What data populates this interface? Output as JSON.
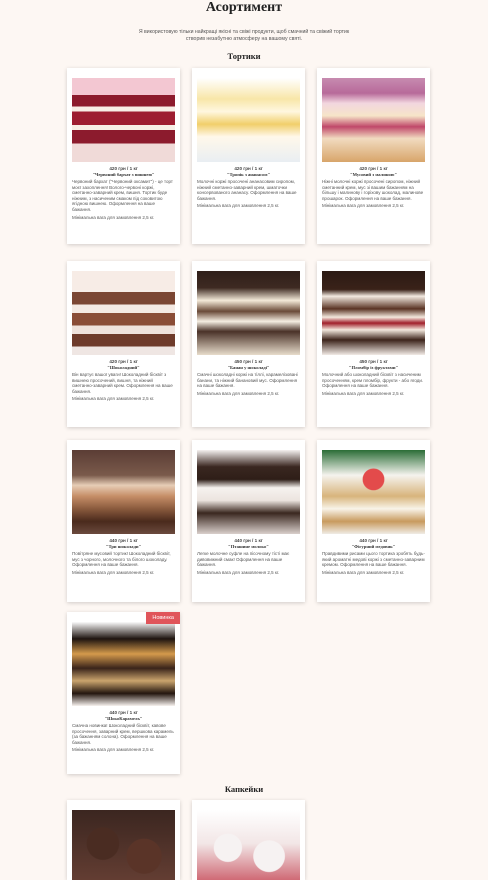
{
  "page": {
    "title": "Асортимент",
    "intro": "Я використовую тільки найкращі якісні та свіжі продукти, щоб смачний та свіжий тортик створив незабутню атмосферу на вашому святі."
  },
  "sections": [
    {
      "title": "Тортики",
      "items": [
        {
          "price": "420 грн / 1 кг",
          "name": "\"Червоний бархат з вишнею\"",
          "desc": "Червоний бархат (\"Червоний оксамит\") - це торт моєї захоплення!\nВолого-червоні коржі, сметанно-заварний крем, вишня. Тортик буде ніжним, з насиченим смаком під соковитою ягідною вишнею. Оформлення на ваше бажання.",
          "min": "Мінімальна вага для замовлення 2,5 кг.",
          "image_icon": "red-velvet-cake-photo"
        },
        {
          "price": "420 грн / 1 кг",
          "name": "\"Тропік з ананасом\"",
          "desc": "Молочні коржі просочені ананасовим сиропом, ніжний сметанно-заварний крем, шматочки консервованого ананасу. Оформлення на ваше бажання.",
          "min": "Мінімальна вага для замовлення 2,5 кг.",
          "image_icon": "pineapple-cake-photo"
        },
        {
          "price": "420 грн / 1 кг",
          "name": "\"Мусовий з малиною\"",
          "desc": "Ніжні молочні коржі просочені сиропом, ніжний сметанний крем, мус зі вашим бажанням на більшу і малинову і горіхову шоколад, малинове прошарок. Оформлення на ваше бажання.",
          "min": "Мінімальна вага для замовлення 2,5 кг.",
          "image_icon": "raspberry-mousse-cake-photo"
        },
        {
          "price": "420 грн / 1 кг",
          "name": "\"Шоколадний\"",
          "desc": "Він вартує вашої уваги!\nШоколадний бісквіт з вишнею просочений, вишня, та ніжний сметанно-заварний крем. Оформлення на ваше бажання.",
          "min": "Мінімальна вага для замовлення 2,5 кг.",
          "image_icon": "chocolate-cherry-cake-photo"
        },
        {
          "price": "450 грн / 1 кг",
          "name": "\"Банан у шоколаді\"",
          "desc": "Смачні шоколадні коржі на тіллі, карамелізовані банани, та ніжний банановий мус. Оформлення на ваше бажання.",
          "min": "Мінімальна вага для замовлення 2,5 кг.",
          "image_icon": "banana-chocolate-cake-photo"
        },
        {
          "price": "450 грн / 1 кг",
          "name": "\"Пломбір із фруктами\"",
          "desc": "Молочний або шоколадний бісквіт з насиченим просоченням, крем пломбір, фрукти - або ягоди. Оформлення на ваше бажання.",
          "min": "Мінімальна вага для замовлення 2,5 кг.",
          "image_icon": "fruit-ice-cream-cake-photo"
        },
        {
          "price": "440 грн / 1 кг",
          "name": "\"Три шоколади\"",
          "desc": "Повітряне мусовий тортик!\nШоколадний бісквіт, мус з чорного, молочного та білого шоколаду. Оформлення на ваше бажання.",
          "min": "Мінімальна вага для замовлення 2,5 кг.",
          "image_icon": "three-chocolates-cake-photo"
        },
        {
          "price": "440 грн / 1 кг",
          "name": "\"Пташине молоко\"",
          "desc": "Легке молочне суфле на пісочному тісті має дивовижний смак! Оформлення на ваше бажання.",
          "min": "Мінімальна вага для замовлення 2,5 кг.",
          "image_icon": "birds-milk-cake-photo"
        },
        {
          "price": "440 грн / 1 кг",
          "name": "\"Фігурний медовик\"",
          "desc": "Правдивими рисами цього тортика зробять будь-який ароматні медові коржі з сметанно-заварним кремом. Оформлення на ваше бажання.",
          "min": "Мінімальна вага для замовлення 2,5 кг.",
          "image_icon": "honey-cake-photo"
        },
        {
          "price": "440 грн / 1 кг",
          "name": "\"ШокоКарамель\"",
          "desc": "Смачна новинка! Шоколадний бісквіт, кавове просочення, заварний крем, вершкова карамель (за бажанням солона). Оформлення на ваше бажання.",
          "min": "Мінімальна вага для замовлення 2,5 кг.",
          "badge": "Новинка",
          "image_icon": "chocolate-caramel-cake-photo"
        }
      ]
    },
    {
      "title": "Капкейки",
      "items": [
        {
          "image_icon": "chocolate-cupcakes-photo"
        },
        {
          "image_icon": "cherry-cupcakes-photo"
        }
      ]
    }
  ]
}
